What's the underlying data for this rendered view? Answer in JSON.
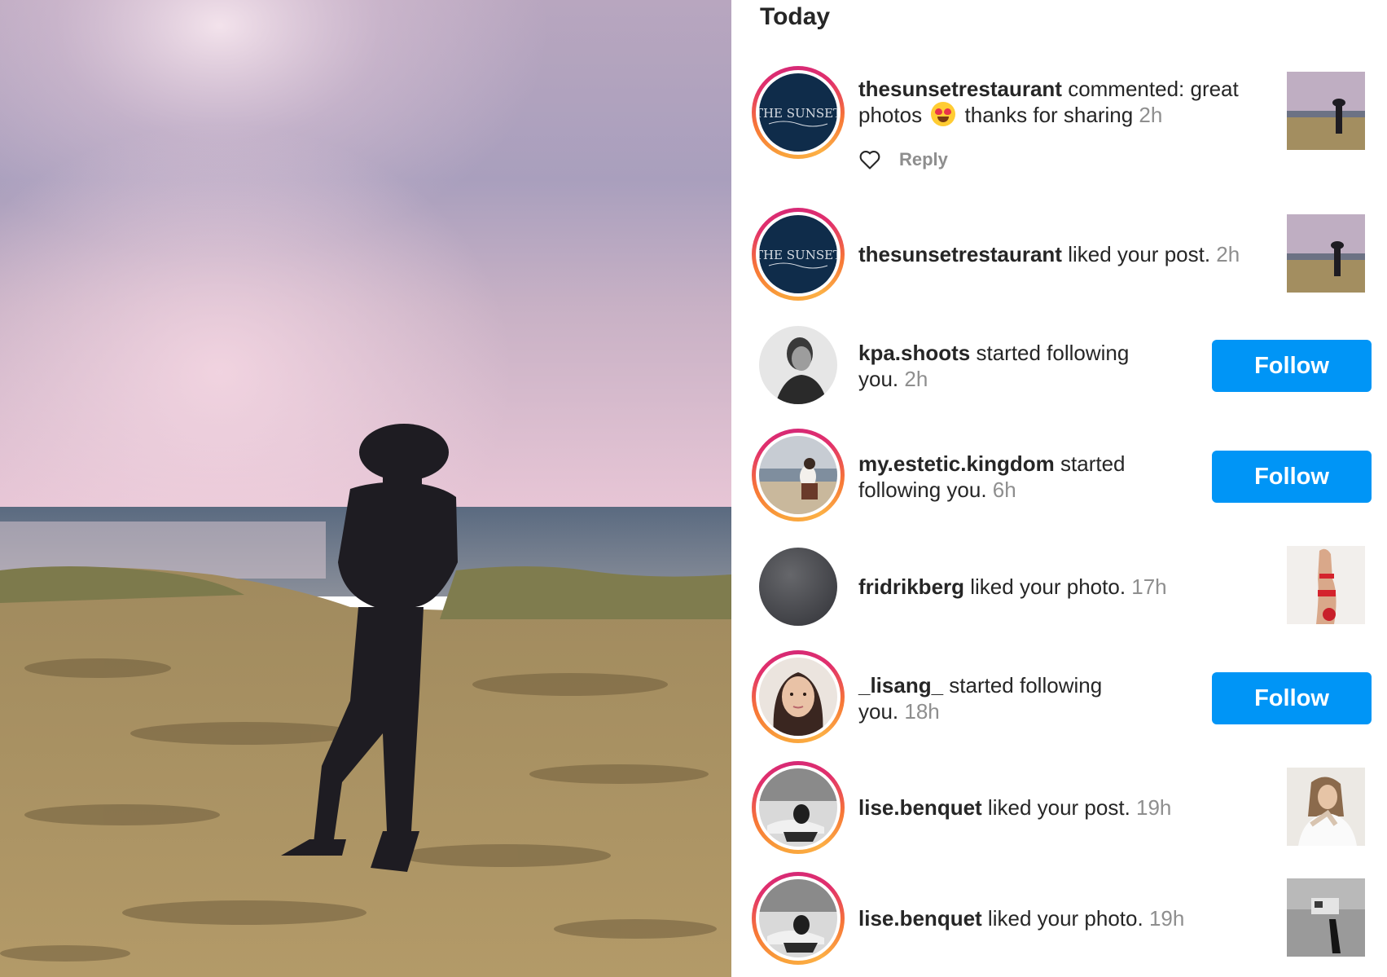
{
  "section_title": "Today",
  "reply_label": "Reply",
  "follow_label": "Follow",
  "notifications": [
    {
      "user": "thesunsetrestaurant",
      "line1": " commented: great",
      "line2_pre": "photos ",
      "line2_post": " thanks for sharing ",
      "time": "2h",
      "emoji": "heart-eyes-emoji"
    },
    {
      "user": "thesunsetrestaurant",
      "action": " liked your post. ",
      "time": "2h"
    },
    {
      "user": "kpa.shoots",
      "line1": " started following",
      "line2": "you. ",
      "time": "2h"
    },
    {
      "user": "my.estetic.kingdom",
      "line1": " started",
      "line2": "following you. ",
      "time": "6h"
    },
    {
      "user": "fridrikberg",
      "action": " liked your photo. ",
      "time": "17h"
    },
    {
      "user": "_lisang_",
      "line1": " started following",
      "line2": "you. ",
      "time": "18h"
    },
    {
      "user": "lise.benquet",
      "action": " liked your post. ",
      "time": "19h"
    },
    {
      "user": "lise.benquet",
      "action": " liked your photo. ",
      "time": "19h"
    }
  ],
  "logo_text": "THE SUNSET",
  "colors": {
    "follow": "#0095f6",
    "text": "#262626",
    "muted": "#8e8e8e",
    "logo_bg": "#0f2c4a"
  }
}
